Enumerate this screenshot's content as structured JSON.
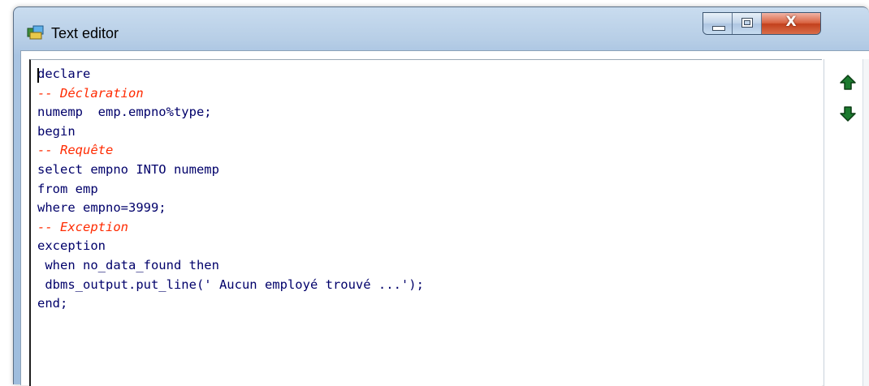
{
  "window": {
    "title": "Text editor",
    "icon": "app-icon",
    "controls": {
      "minimize": "minimize-icon",
      "maximize": "maximize-icon",
      "close_label": "X"
    }
  },
  "editor": {
    "lines": [
      {
        "text": "declare",
        "type": "code"
      },
      {
        "text": "-- Déclaration",
        "type": "comment"
      },
      {
        "text": "numemp  emp.empno%type;",
        "type": "code"
      },
      {
        "text": "begin",
        "type": "code"
      },
      {
        "text": "-- Requête",
        "type": "comment"
      },
      {
        "text": "select empno INTO numemp",
        "type": "code"
      },
      {
        "text": "from emp",
        "type": "code"
      },
      {
        "text": "where empno=3999;",
        "type": "code"
      },
      {
        "text": "-- Exception",
        "type": "comment"
      },
      {
        "text": "exception",
        "type": "code"
      },
      {
        "text": " when no_data_found then",
        "type": "code"
      },
      {
        "text": " dbms_output.put_line(' Aucun employé trouvé ...');",
        "type": "code"
      },
      {
        "text": "end;",
        "type": "code"
      }
    ],
    "colors": {
      "code": "#00006a",
      "comment": "#ff2a00"
    }
  },
  "side_buttons": {
    "up": "arrow-up-icon",
    "down": "arrow-down-icon",
    "color": "#1b6b2a"
  }
}
